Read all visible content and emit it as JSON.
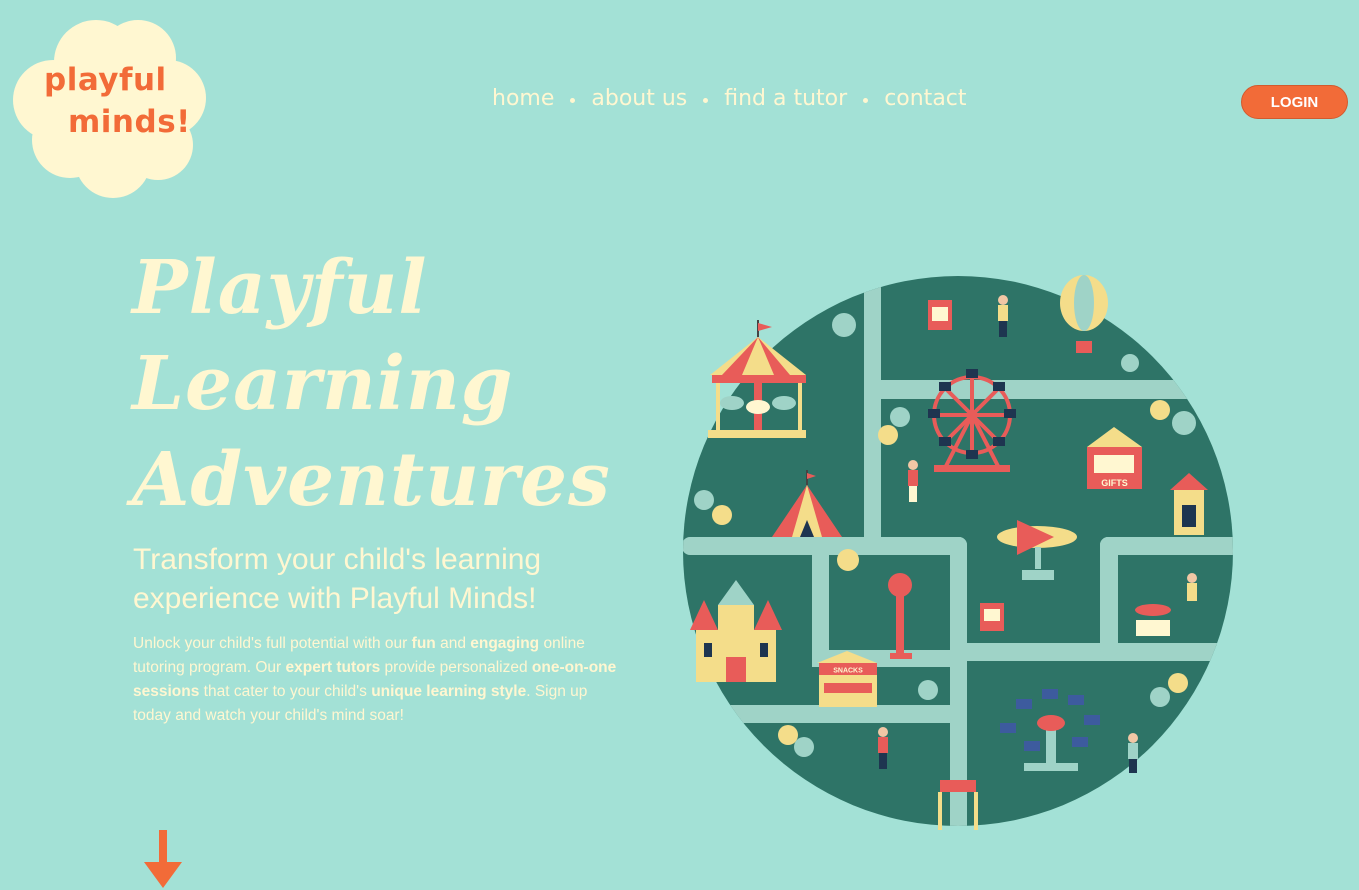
{
  "brand": {
    "line1": "playful",
    "line2": "minds!"
  },
  "nav": {
    "items": [
      "home",
      "about us",
      "find a tutor",
      "contact"
    ]
  },
  "login_label": "LOGIN",
  "hero": {
    "title_lines": [
      "Playful",
      "Learning",
      "Adventures"
    ],
    "subtitle": "Transform your child's learning experience with Playful Minds!",
    "desc": [
      {
        "t": "Unlock your child's full potential with our ",
        "b": false
      },
      {
        "t": "fun",
        "b": true
      },
      {
        "t": " and ",
        "b": false
      },
      {
        "t": "engaging",
        "b": true
      },
      {
        "t": " online tutoring program. Our ",
        "b": false
      },
      {
        "t": "expert tutors",
        "b": true
      },
      {
        "t": " provide personalized ",
        "b": false
      },
      {
        "t": "one-on-one sessions",
        "b": true
      },
      {
        "t": " that cater to your child's ",
        "b": false
      },
      {
        "t": "unique learning style",
        "b": true
      },
      {
        "t": ". Sign up today and watch your child's mind soar!",
        "b": false
      }
    ]
  },
  "illustration": {
    "labels": {
      "gifts": "GIFTS",
      "snacks": "SNACKS"
    }
  },
  "colors": {
    "bg": "#a3e1d6",
    "accent": "#f26b38",
    "cream": "#fff7d1",
    "park": "#2e7467",
    "path": "#9fd3c7"
  }
}
